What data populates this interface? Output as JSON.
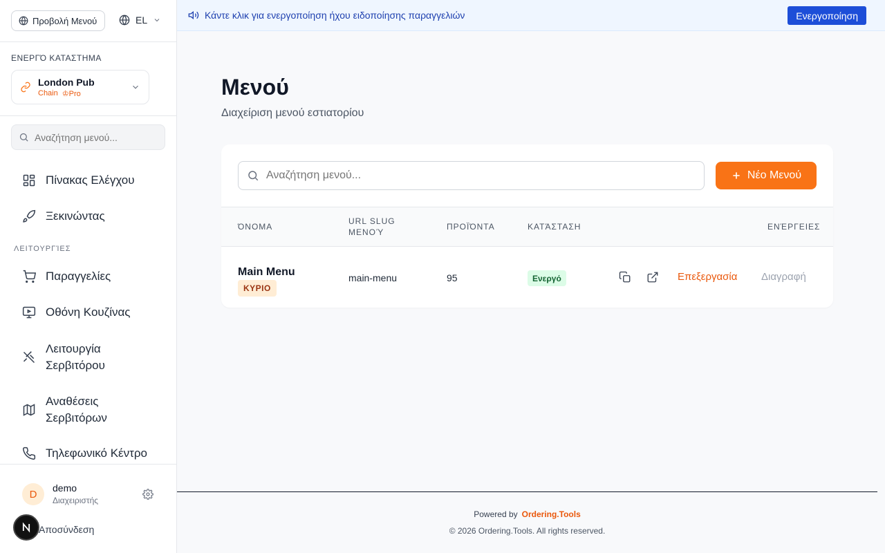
{
  "sidebar": {
    "view_menu_label": "Προβολή Μενού",
    "language": "EL",
    "store_section_label": "ΕΝΕΡΓΌ ΚΑΤΑΣΤΗΜΑ",
    "store": {
      "name": "London Pub",
      "type": "Chain",
      "plan": "Pro"
    },
    "search_placeholder": "Αναζήτηση μενού...",
    "nav_items": [
      {
        "label": "Πίνακας Ελέγχου",
        "icon": "dashboard-icon"
      },
      {
        "label": "Ξεκινώντας",
        "icon": "rocket-icon"
      }
    ],
    "functions_label": "ΛΕΙΤΟΥΡΓΊΕΣ",
    "function_items": [
      {
        "label": "Παραγγελίες",
        "icon": "cart-icon"
      },
      {
        "label": "Οθόνη Κουζίνας",
        "icon": "monitor-icon"
      },
      {
        "label": "Λειτουργία Σερβιτόρου",
        "icon": "utensils-icon"
      },
      {
        "label": "Αναθέσεις Σερβιτόρων",
        "icon": "map-icon"
      },
      {
        "label": "Τηλεφωνικό Κέντρο",
        "icon": "phone-icon"
      }
    ],
    "user": {
      "initial": "D",
      "name": "demo",
      "role": "Διαχειριστής"
    },
    "logout_label": "Αποσύνδεση"
  },
  "banner": {
    "text": "Κάντε κλικ για ενεργοποίηση ήχου ειδοποίησης παραγγελιών",
    "button_label": "Ενεργοποίηση"
  },
  "main": {
    "title": "Μενού",
    "subtitle": "Διαχείριση μενού εστιατορίου",
    "search_placeholder": "Αναζήτηση μενού...",
    "new_button_label": "Νέο Μενού",
    "table": {
      "headers": {
        "name": "ΌΝΟΜΑ",
        "slug_line1": "URL SLUG",
        "slug_line2": "ΜΕΝΟΎ",
        "products": "ΠΡΟΪΌΝΤΑ",
        "status": "ΚΑΤΆΣΤΑΣΗ",
        "actions": "ΕΝΈΡΓΕΙΕΣ"
      },
      "rows": [
        {
          "name": "Main Menu",
          "badge": "ΚΥΡΙΟ",
          "slug": "main-menu",
          "products": "95",
          "status": "Ενεργό",
          "edit_label": "Επεξεργασία",
          "delete_label": "Διαγραφή"
        }
      ]
    }
  },
  "footer": {
    "powered_by": "Powered by",
    "brand": "Ordering.Tools",
    "copyright": "© 2026 Ordering.Tools. All rights reserved."
  },
  "colors": {
    "accent": "#f97316",
    "banner_button": "#1d4ed8",
    "status_active_bg": "#dcfce7"
  }
}
